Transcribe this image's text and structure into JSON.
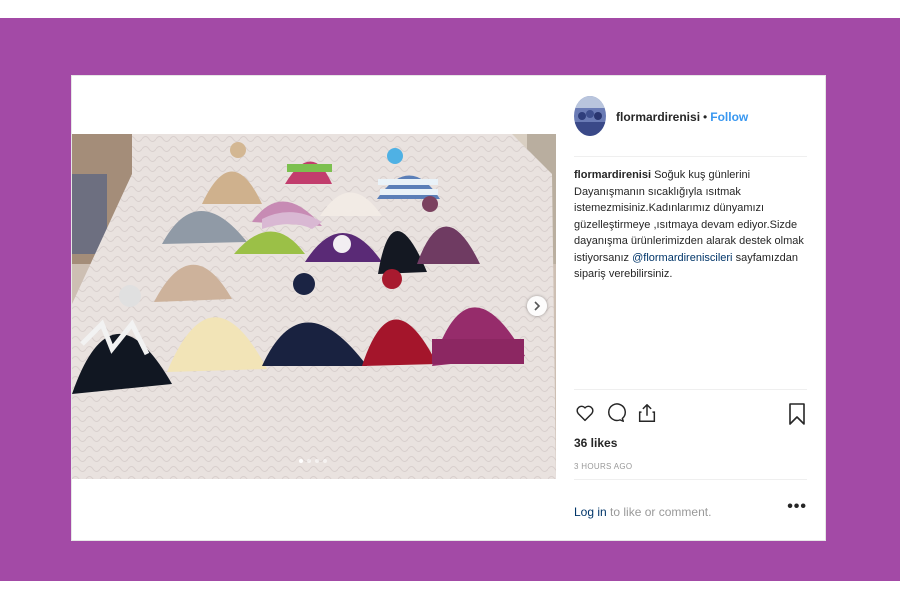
{
  "post": {
    "username": "flormardirenisi",
    "separator": "•",
    "follow_label": "Follow",
    "caption_text": "Soğuk kuş günlerini Dayanışmanın sıcaklığıyla ısıtmak istemezmisiniz.Kadınlarımız dünyamızı güzelleştirmeye ,ısıtmaya devam ediyor.Sizde dayanışma ürünlerimizden alarak destek olmak istiyorsanız",
    "caption_mention": "@flormardireniscileri",
    "caption_end": "sayfamızdan sipariş verebilirsiniz.",
    "likes": "36 likes",
    "time": "3 HOURS AGO",
    "login_link": "Log in",
    "login_rest": "to like or comment.",
    "more_label": "•••"
  },
  "carousel": {
    "slides": 4,
    "active": 1
  },
  "icons": [
    "heart-icon",
    "comment-icon",
    "share-icon",
    "bookmark-icon",
    "chevron-right-icon"
  ],
  "colors": {
    "frame": "#a34aa6",
    "link": "#3897f0",
    "text": "#262626",
    "muted": "#999999"
  }
}
